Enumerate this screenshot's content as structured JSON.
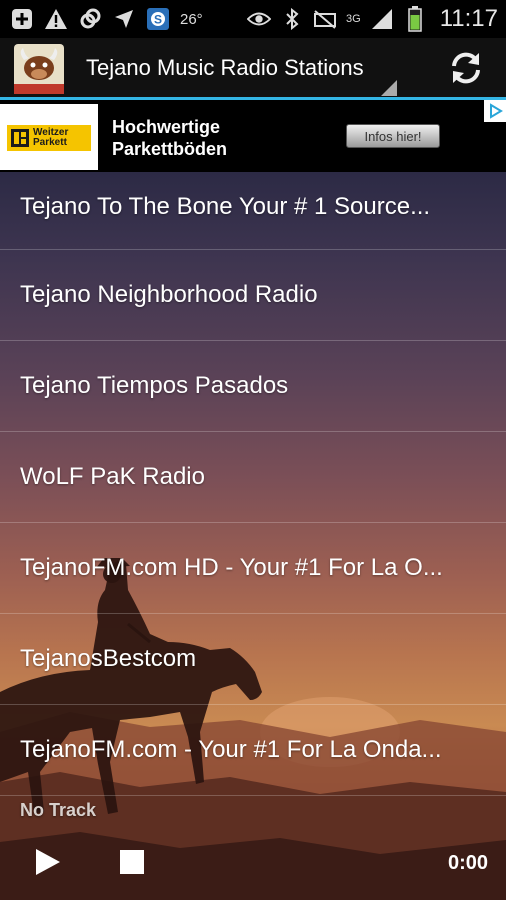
{
  "status_bar": {
    "temperature": "26°",
    "network": "3G",
    "clock": "11:17",
    "left_icons": [
      "add-icon",
      "warning-icon",
      "sync-icon",
      "location-icon",
      "skype-icon"
    ],
    "right_icons": [
      "eye-icon",
      "bluetooth-icon",
      "mute-icon",
      "signal-icon",
      "battery-icon"
    ]
  },
  "action_bar": {
    "logo_text": "Tejano Music Radio",
    "title": "Tejano Music Radio Stations",
    "refresh_icon": "refresh-icon"
  },
  "ad": {
    "brand_line1": "Weitzer",
    "brand_line2": "Parkett",
    "headline_line1": "Hochwertige",
    "headline_line2": "Parkettböden",
    "button_label": "Infos hier!",
    "choices_icon": "ad-choices-icon"
  },
  "stations": [
    "Tejano To The Bone Your # 1 Source...",
    "Tejano Neighborhood Radio",
    "Tejano Tiempos Pasados",
    "WoLF PaK Radio",
    "TejanoFM.com HD - Your #1 For La O...",
    "TejanosBestcom",
    "TejanoFM.com - Your #1 For La Onda..."
  ],
  "player": {
    "track": "No Track",
    "play_icon": "play-icon",
    "stop_icon": "stop-icon",
    "time": "0:00"
  },
  "colors": {
    "accent": "#33b5e5",
    "ad_brand_yellow": "#f5c400"
  }
}
